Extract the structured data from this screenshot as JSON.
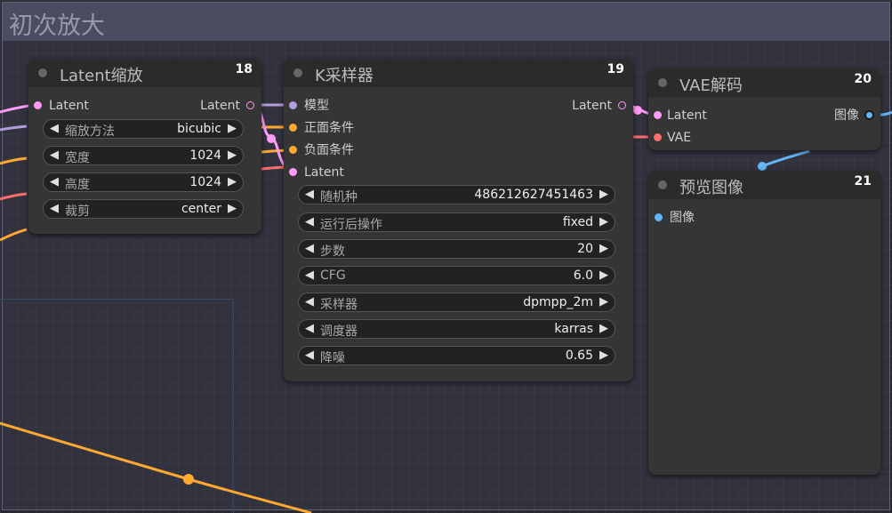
{
  "group": {
    "title": "初次放大"
  },
  "colors": {
    "latent": "#ff9cf9",
    "model": "#b39ddb",
    "conditioning": "#ffa931",
    "vae": "#ff6e6e",
    "image": "#64b5f6"
  },
  "nodes": {
    "latent_upscale": {
      "title": "Latent缩放",
      "id": "18",
      "input": "Latent",
      "output": "Latent",
      "widgets": [
        {
          "label": "缩放方法",
          "value": "bicubic"
        },
        {
          "label": "宽度",
          "value": "1024"
        },
        {
          "label": "高度",
          "value": "1024"
        },
        {
          "label": "裁剪",
          "value": "center"
        }
      ]
    },
    "ksampler": {
      "title": "K采样器",
      "id": "19",
      "inputs": [
        "模型",
        "正面条件",
        "负面条件",
        "Latent"
      ],
      "output": "Latent",
      "widgets": [
        {
          "label": "随机种",
          "value": "486212627451463"
        },
        {
          "label": "运行后操作",
          "value": "fixed"
        },
        {
          "label": "步数",
          "value": "20"
        },
        {
          "label": "CFG",
          "value": "6.0"
        },
        {
          "label": "采样器",
          "value": "dpmpp_2m"
        },
        {
          "label": "调度器",
          "value": "karras"
        },
        {
          "label": "降噪",
          "value": "0.65"
        }
      ]
    },
    "vae_decode": {
      "title": "VAE解码",
      "id": "20",
      "inputs": [
        "Latent",
        "VAE"
      ],
      "output": "图像"
    },
    "preview_image": {
      "title": "预览图像",
      "id": "21",
      "input": "图像"
    }
  }
}
